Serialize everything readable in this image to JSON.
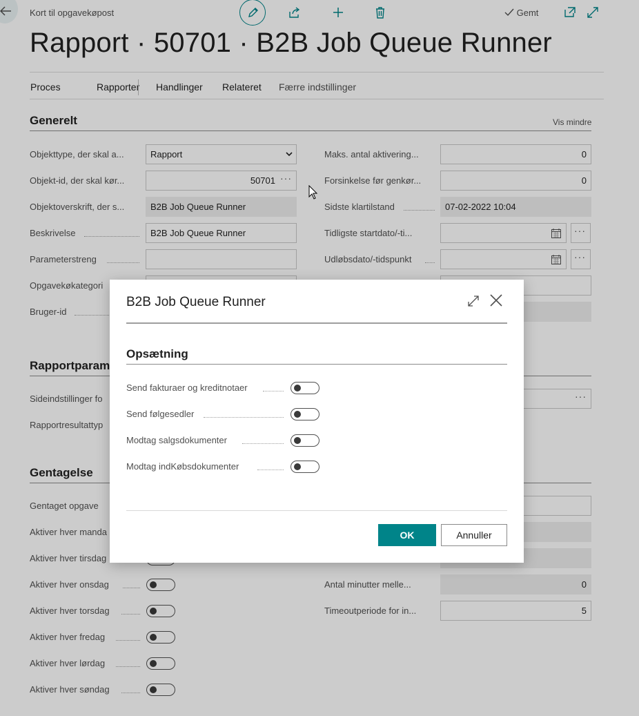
{
  "header": {
    "breadcrumb": "Kort til opgavekøpost",
    "saved_label": "Gemt",
    "page_title": "Rapport · 50701 · B2B Job Queue Runner"
  },
  "actions": {
    "items": [
      "Proces",
      "Rapporter",
      "Handlinger",
      "Relateret",
      "Færre indstillinger"
    ]
  },
  "general": {
    "title": "Generelt",
    "show_less": "Vis mindre",
    "left": [
      {
        "label": "Objekttype, der skal a...",
        "value": "Rapport"
      },
      {
        "label": "Objekt-id, der skal kør...",
        "value": "50701"
      },
      {
        "label": "Objektoverskrift, der s...",
        "value": "B2B Job Queue Runner"
      },
      {
        "label": "Beskrivelse",
        "value": "B2B Job Queue Runner"
      },
      {
        "label": "Parameterstreng",
        "value": ""
      },
      {
        "label": "Opgavekøkategori",
        "value": ""
      },
      {
        "label": "Bruger-id",
        "value": ""
      }
    ],
    "right": [
      {
        "label": "Maks. antal aktivering...",
        "value": "0"
      },
      {
        "label": "Forsinkelse før genkør...",
        "value": "0"
      },
      {
        "label": "Sidste klartilstand",
        "value": "07-02-2022 10:04"
      },
      {
        "label": "Tidligste startdato/-ti...",
        "value": ""
      },
      {
        "label": "Udløbsdato/-tidspunkt",
        "value": ""
      }
    ]
  },
  "report_params": {
    "title": "Rapportparam",
    "labels": [
      "Sideindstillinger fo",
      "Rapportresultattyp"
    ]
  },
  "recurrence": {
    "title": "Gentagelse",
    "left": [
      {
        "label": "Gentaget opgave"
      },
      {
        "label": "Aktiver hver manda"
      },
      {
        "label": "Aktiver hver tirsdag"
      },
      {
        "label": "Aktiver hver onsdag"
      },
      {
        "label": "Aktiver hver torsdag"
      },
      {
        "label": "Aktiver hver fredag"
      },
      {
        "label": "Aktiver hver lørdag"
      },
      {
        "label": "Aktiver hver søndag"
      }
    ],
    "right": [
      {
        "label": "Antal minutter melle...",
        "value": "0"
      },
      {
        "label": "Timeoutperiode for in...",
        "value": "5"
      }
    ]
  },
  "dialog": {
    "title": "B2B Job Queue Runner",
    "section": "Opsætning",
    "toggles": [
      {
        "label": "Send fakturaer og kreditnotaer",
        "on": false
      },
      {
        "label": "Send følgesedler",
        "on": false
      },
      {
        "label": "Modtag salgsdokumenter",
        "on": false
      },
      {
        "label": "Modtag indKøbsdokumenter",
        "on": false
      }
    ],
    "ok_label": "OK",
    "cancel_label": "Annuller"
  },
  "colors": {
    "accent": "#008489",
    "overlay": "rgba(0,0,0,0.20)"
  }
}
